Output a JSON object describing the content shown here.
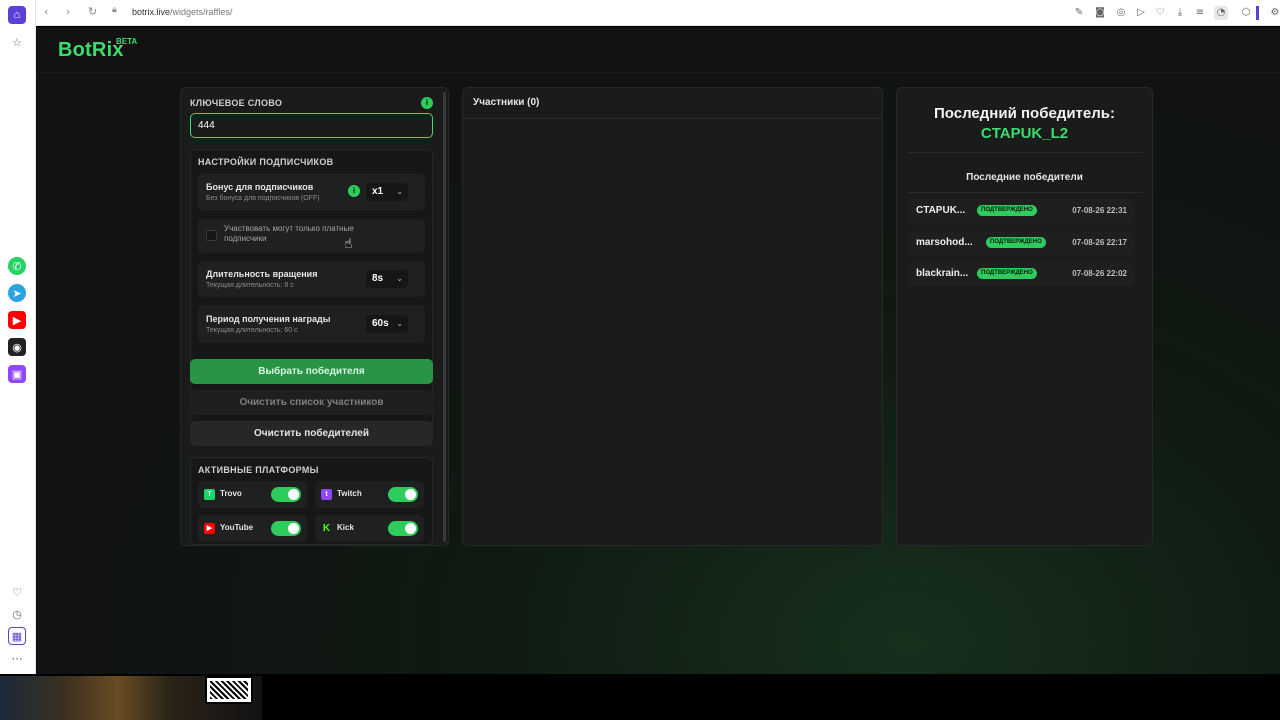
{
  "browser": {
    "url_host": "botrix.live",
    "url_path": "/widgets/raffles/"
  },
  "app": {
    "logo": "BotRix",
    "beta": "BETA"
  },
  "keyword": {
    "label": "КЛЮЧЕВОЕ СЛОВО",
    "value": "444"
  },
  "subscribers": {
    "section_title": "НАСТРОЙКИ ПОДПИСЧИКОВ",
    "bonus_title": "Бонус для подписчиков",
    "bonus_sub": "Без бонуса для подписчиков (OFF)",
    "bonus_value": "x1",
    "only_paid_label": "Участвовать могут только платные подписчики",
    "spin_title": "Длительность вращения",
    "spin_sub": "Текущая длительность: 8 с",
    "spin_value": "8s",
    "claim_title": "Период получения награды",
    "claim_sub": "Текущая длительность: 60 с",
    "claim_value": "60s"
  },
  "buttons": {
    "pick_winner": "Выбрать победителя",
    "clear_participants": "Очистить список участников",
    "clear_winners": "Очистить победителей"
  },
  "platforms": {
    "section_title": "АКТИВНЫЕ ПЛАТФОРМЫ",
    "items": [
      {
        "name": "Trovo",
        "color": "#19d66b",
        "enabled": true
      },
      {
        "name": "Twitch",
        "color": "#9146ff",
        "enabled": true
      },
      {
        "name": "YouTube",
        "color": "#ff0000",
        "enabled": true
      },
      {
        "name": "Kick",
        "color": "#53fc18",
        "enabled": true
      }
    ]
  },
  "participants": {
    "title": "Участники (0)"
  },
  "winner": {
    "title": "Последний победитель:",
    "name": "CTAPUK_L2",
    "recent_title": "Последние победители",
    "recent": [
      {
        "name": "CTAPUK...",
        "status": "ПОДТВЕРЖДЕНО",
        "time": "07-08-26 22:31"
      },
      {
        "name": "marsohod...",
        "status": "ПОДТВЕРЖДЕНО",
        "time": "07-08-26 22:17"
      },
      {
        "name": "blackrain...",
        "status": "ПОДТВЕРЖДЕНО",
        "time": "07-08-26 22:02"
      }
    ]
  },
  "colors": {
    "accent": "#3ddc6f",
    "badge": "#2ecc5c"
  }
}
